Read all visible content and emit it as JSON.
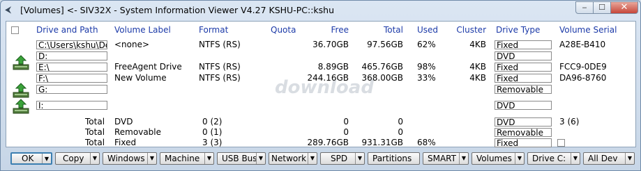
{
  "window": {
    "title": "[Volumes] <- SIV32X - System Information Viewer V4.27 KSHU-PC::kshu"
  },
  "header": {
    "drive_path": "Drive and Path",
    "volume_label": "Volume Label",
    "format": "Format",
    "quota": "Quota",
    "free": "Free",
    "total": "Total",
    "used": "Used",
    "cluster": "Cluster",
    "drive_type": "Drive Type",
    "volume_serial": "Volume Serial"
  },
  "rows": [
    {
      "path": "C:\\Users\\kshu\\Des",
      "label": "<none>",
      "format": "NTFS (RS)",
      "free": "36.70GB",
      "total": "97.56GB",
      "used": "62%",
      "cluster": "4KB",
      "type": "Fixed",
      "serial": "A28E-B410"
    },
    {
      "path": "D:",
      "label": "",
      "format": "",
      "free": "",
      "total": "",
      "used": "",
      "cluster": "",
      "type": "DVD",
      "serial": ""
    },
    {
      "path": "E:\\",
      "label": "FreeAgent Drive",
      "format": "NTFS (RS)",
      "free": "8.89GB",
      "total": "465.76GB",
      "used": "98%",
      "cluster": "4KB",
      "type": "Fixed",
      "serial": "FCC9-0DE9"
    },
    {
      "path": "F:\\",
      "label": "New Volume",
      "format": "NTFS (RS)",
      "free": "244.16GB",
      "total": "368.00GB",
      "used": "33%",
      "cluster": "4KB",
      "type": "Fixed",
      "serial": "DA96-8760"
    },
    {
      "path": "G:",
      "label": "",
      "format": "",
      "free": "",
      "total": "",
      "used": "",
      "cluster": "",
      "type": "Removable",
      "serial": ""
    },
    {
      "path": "I:",
      "label": "",
      "format": "",
      "free": "",
      "total": "",
      "used": "",
      "cluster": "",
      "type": "DVD",
      "serial": ""
    }
  ],
  "totals": [
    {
      "label": "Total",
      "kind": "DVD",
      "count": "0 (2)",
      "free": "0",
      "total": "0",
      "used": "",
      "type": "DVD",
      "serial": "3 (6)"
    },
    {
      "label": "Total",
      "kind": "Removable",
      "count": "0 (1)",
      "free": "0",
      "total": "0",
      "used": "",
      "type": "Removable",
      "serial": ""
    },
    {
      "label": "Total",
      "kind": "Fixed",
      "count": "3 (3)",
      "free": "289.76GB",
      "total": "931.31GB",
      "used": "68%",
      "type": "Fixed",
      "serial": ""
    }
  ],
  "watermark": "download",
  "buttons": {
    "ok": "OK",
    "copy": "Copy",
    "windows": "Windows",
    "machine": "Machine",
    "usb_bus": "USB Bus",
    "network": "Network",
    "spd": "SPD",
    "partitions": "Partitions",
    "smart": "SMART",
    "volumes": "Volumes",
    "drive_c": "Drive C:",
    "all_dev": "All Dev"
  },
  "colors": {
    "header_text": "#1c3aa8",
    "window_frame": "#cfdbe8",
    "close_button": "#c6463a"
  },
  "icons": {
    "app": "back-arrow-icon",
    "drive": "network-drive-icon"
  }
}
